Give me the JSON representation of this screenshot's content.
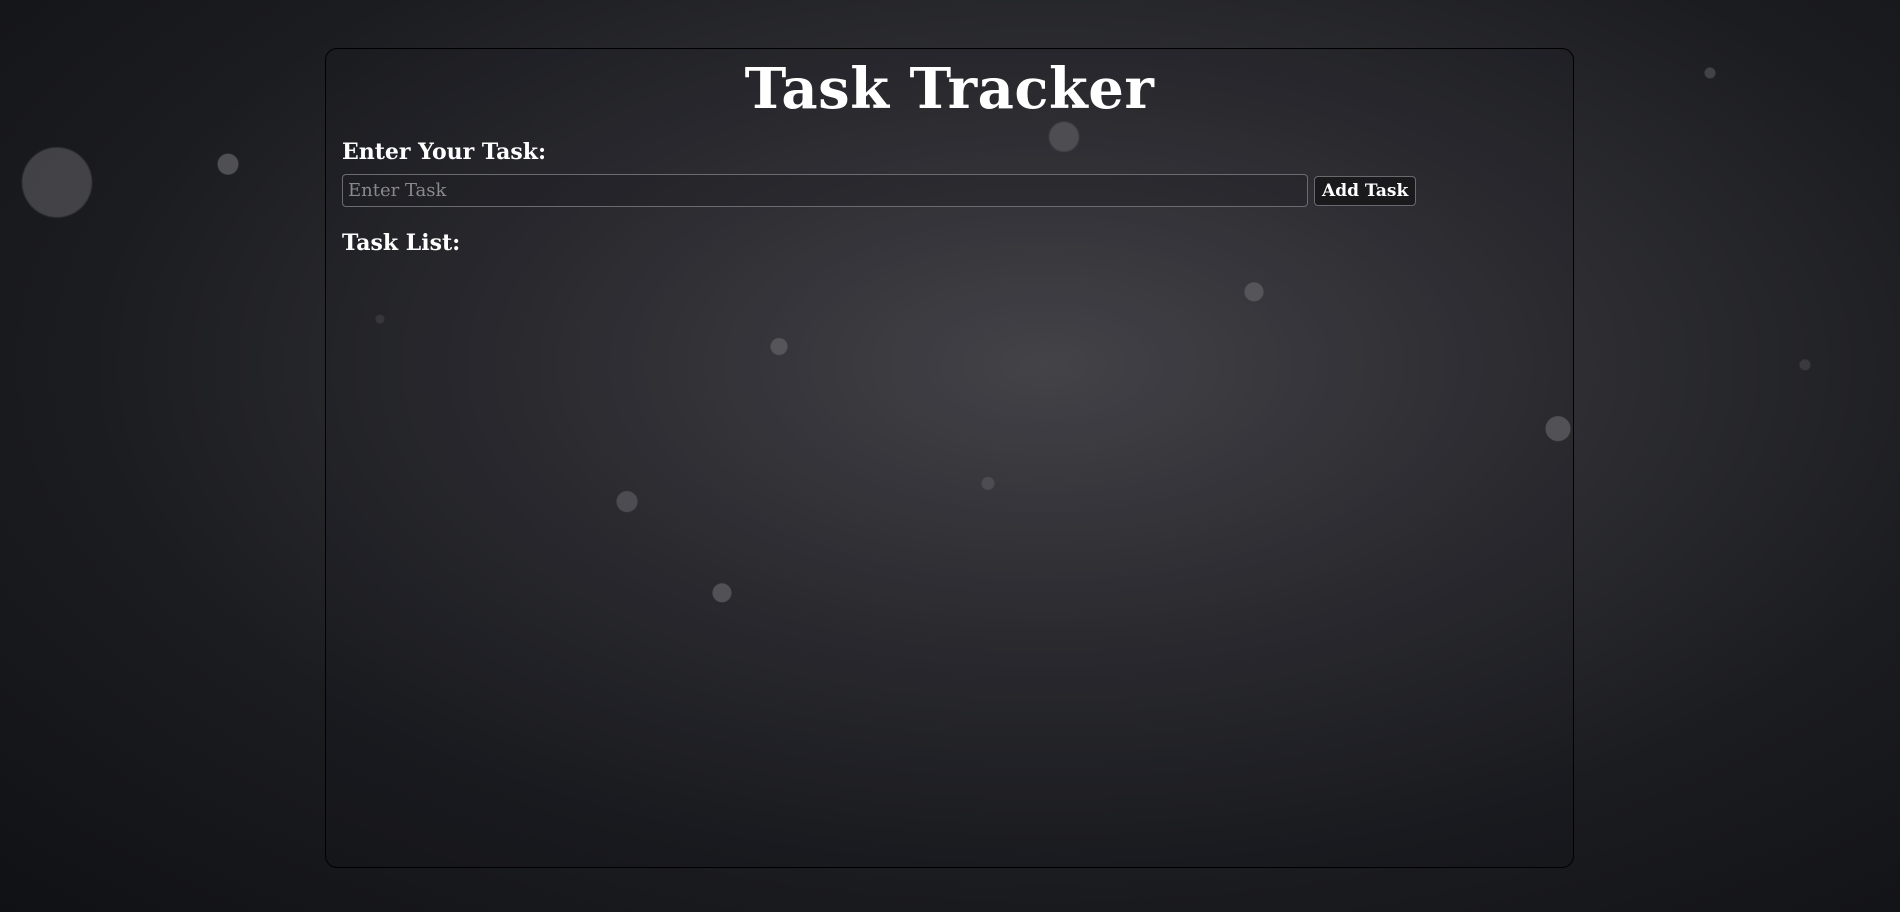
{
  "app": {
    "title": "Task Tracker"
  },
  "form": {
    "enter_label": "Enter Your Task:",
    "input_value": "",
    "input_placeholder": "Enter Task",
    "add_button_label": "Add Task"
  },
  "task_list": {
    "label": "Task List:",
    "items": []
  },
  "colors": {
    "text": "#ffffff",
    "panel_border": "#000000",
    "button_bg": "#1a1a1d"
  }
}
